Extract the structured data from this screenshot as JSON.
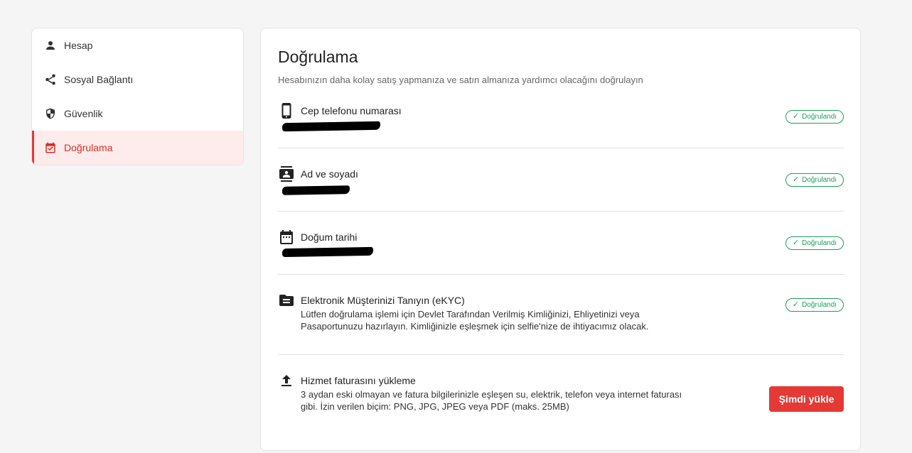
{
  "sidebar": {
    "items": [
      {
        "label": "Hesap",
        "icon": "person-icon"
      },
      {
        "label": "Sosyal Bağlantı",
        "icon": "share-icon"
      },
      {
        "label": "Güvenlik",
        "icon": "shield-icon"
      },
      {
        "label": "Doğrulama",
        "icon": "verify-calendar-icon",
        "active": true
      }
    ]
  },
  "main": {
    "title": "Doğrulama",
    "subtitle": "Hesabınızın daha kolay satış yapmanıza ve satın almanıza yardımcı olacağını doğrulayın",
    "rows": [
      {
        "title": "Cep telefonu numarası",
        "status": "Doğrulandı",
        "icon": "phone-icon",
        "value_redacted": true
      },
      {
        "title": "Ad ve soyadı",
        "status": "Doğrulandı",
        "icon": "contact-card-icon",
        "value_redacted": true
      },
      {
        "title": "Doğum tarihi",
        "status": "Doğrulandı",
        "icon": "calendar-icon",
        "value_redacted": true
      },
      {
        "title": "Elektronik Müşterinizi Tanıyın (eKYC)",
        "status": "Doğrulandı",
        "icon": "folder-document-icon",
        "description": "Lütfen doğrulama işlemi için Devlet Tarafından Verilmiş Kimliğinizi, Ehliyetinizi veya Pasaportunuzu hazırlayın. Kimliğinizle eşleşmek için selfie'nize de ihtiyacımız olacak."
      },
      {
        "title": "Hizmet faturasını yükleme",
        "icon": "upload-icon",
        "description": "3 aydan eski olmayan ve fatura bilgilerinizle eşleşen su, elektrik, telefon veya internet faturası gibi. İzin verilen biçim: PNG, JPG, JPEG veya PDF (maks. 25MB)",
        "button_label": "Şimdi yükle"
      }
    ]
  },
  "colors": {
    "accent": "#e53935",
    "active_bg": "#fdeceb",
    "verified": "#1e9e5a",
    "background": "#f5f5f5"
  }
}
